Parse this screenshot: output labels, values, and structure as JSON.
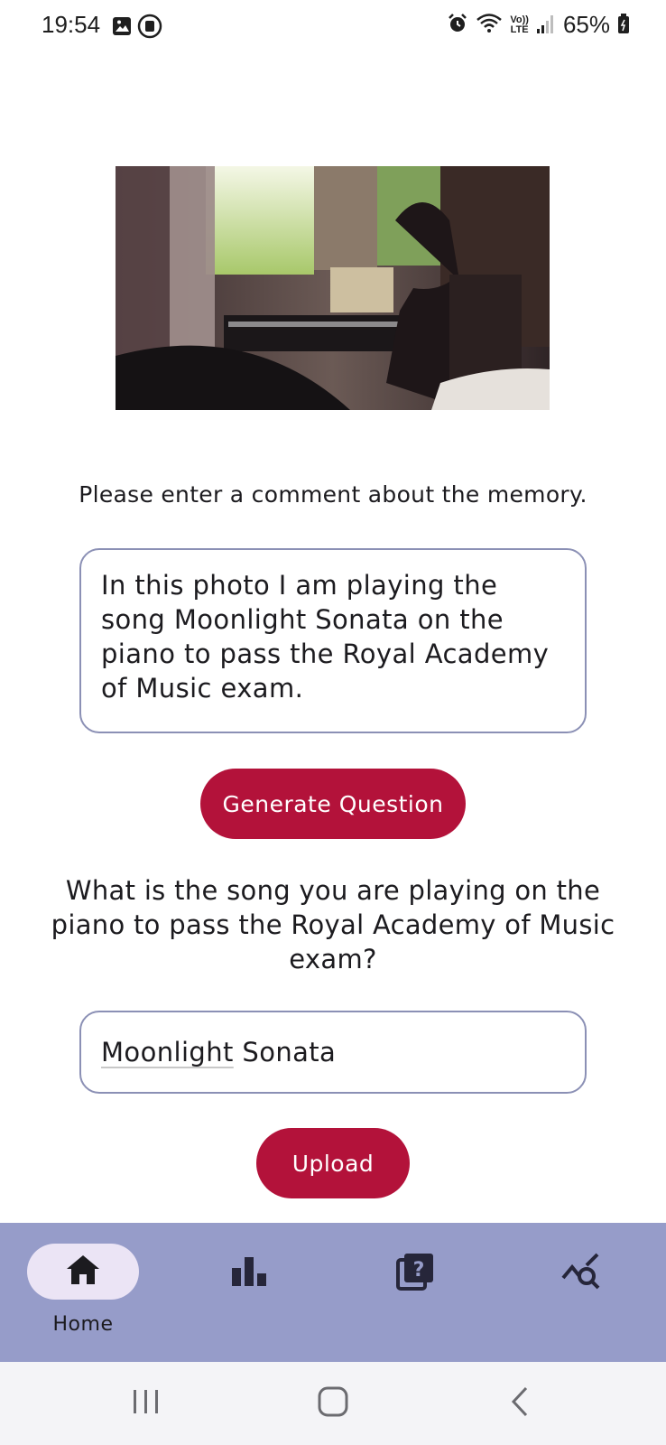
{
  "status_bar": {
    "time": "19:54",
    "battery": "65%",
    "lte_top": "Vo))",
    "lte_bottom": "LTE",
    "icons_left": [
      "gallery-icon",
      "screen-record-icon"
    ],
    "icons_right": [
      "alarm-icon",
      "wifi-icon",
      "volte-icon",
      "signal-icon",
      "battery-icon"
    ]
  },
  "photo": {
    "description_icon": "memory-photo"
  },
  "prompt": "Please enter a comment about the memory.",
  "comment": {
    "value": "In this photo I am playing the song Moonlight Sonata on the piano to pass the Royal Academy of Music exam."
  },
  "generate_button": "Generate Question",
  "question": "What is the song you are playing on the piano to pass the Royal Academy of Music exam?",
  "answer": {
    "value_underlined": "Moonlight",
    "value_rest": " Sonata"
  },
  "upload_button": "Upload",
  "bottom_nav": {
    "items": [
      {
        "label": "Home",
        "icon": "home-icon",
        "active": true
      },
      {
        "label": "",
        "icon": "bar-chart-icon",
        "active": false
      },
      {
        "label": "",
        "icon": "quiz-icon",
        "active": false
      },
      {
        "label": "",
        "icon": "query-stats-icon",
        "active": false
      }
    ]
  },
  "colors": {
    "accent": "#b3123a",
    "nav_background": "#969cc9",
    "nav_active_pill": "#ebe4f5",
    "field_border": "#8b90b5"
  }
}
